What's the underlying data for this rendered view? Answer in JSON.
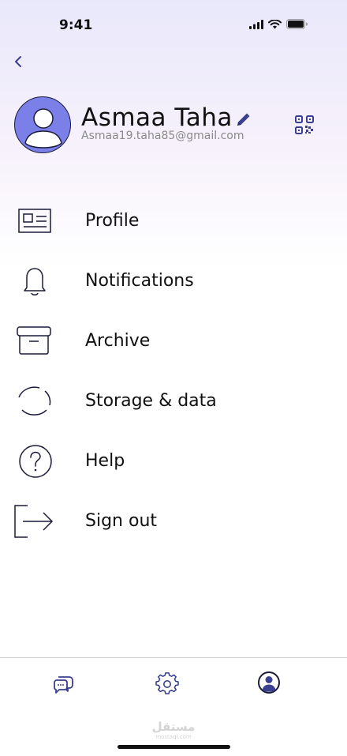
{
  "status_bar": {
    "time": "9:41"
  },
  "profile": {
    "name": "Asmaa Taha",
    "email": "Asmaa19.taha85@gmail.com",
    "avatar_color": "#7b80e8"
  },
  "menu": [
    {
      "label": "Profile",
      "icon": "id-card-icon"
    },
    {
      "label": "Notifications",
      "icon": "bell-icon"
    },
    {
      "label": "Archive",
      "icon": "archive-box-icon"
    },
    {
      "label": "Storage & data",
      "icon": "storage-ring-icon"
    },
    {
      "label": "Help",
      "icon": "question-circle-icon"
    },
    {
      "label": "Sign out",
      "icon": "sign-out-icon"
    }
  ],
  "tab_bar": {
    "tabs": [
      "chats",
      "settings",
      "profile"
    ],
    "active": "profile"
  },
  "watermark": {
    "text": "مستقل",
    "sub": "mostaql.com"
  },
  "colors": {
    "accent": "#3a3f8f",
    "icon_stroke": "#1b1b3a"
  }
}
